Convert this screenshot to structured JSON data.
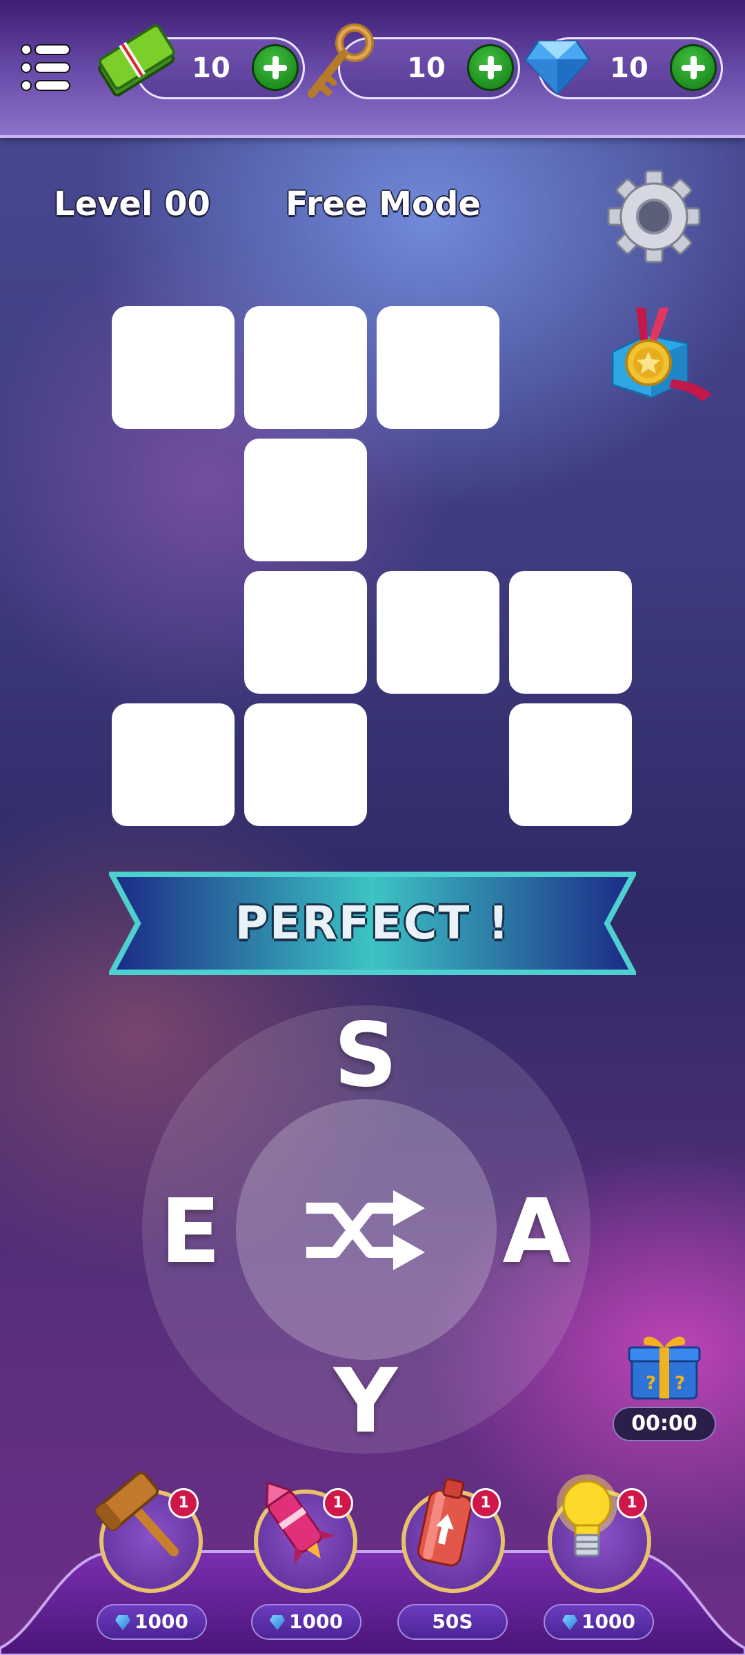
{
  "currency": {
    "cash": {
      "icon": "cash-icon",
      "value": "10"
    },
    "keys": {
      "icon": "key-icon",
      "value": "10"
    },
    "gems": {
      "icon": "gem-icon",
      "value": "10"
    }
  },
  "header": {
    "level": "Level 00",
    "mode": "Free Mode"
  },
  "banner": {
    "text": "PERFECT !"
  },
  "wheel": {
    "letters": [
      "S",
      "E",
      "A",
      "Y"
    ],
    "center_icon": "shuffle-icon"
  },
  "bonus": {
    "icon": "mystery-gift-icon",
    "timer": "00:00"
  },
  "powerups": [
    {
      "icon": "hammer-icon",
      "count": "1",
      "cost": "1000",
      "cost_icon": "gem-icon"
    },
    {
      "icon": "rocket-icon",
      "count": "1",
      "cost": "1000",
      "cost_icon": "gem-icon"
    },
    {
      "icon": "spray-can-icon",
      "count": "1",
      "cost": "50S",
      "cost_icon": ""
    },
    {
      "icon": "lightbulb-icon",
      "count": "1",
      "cost": "1000",
      "cost_icon": "gem-icon"
    }
  ],
  "colors": {
    "accent": "#1f9a1f",
    "banner_border": "#4fd0d0",
    "badge": "#d0174a",
    "ring": "#e8c26b"
  }
}
